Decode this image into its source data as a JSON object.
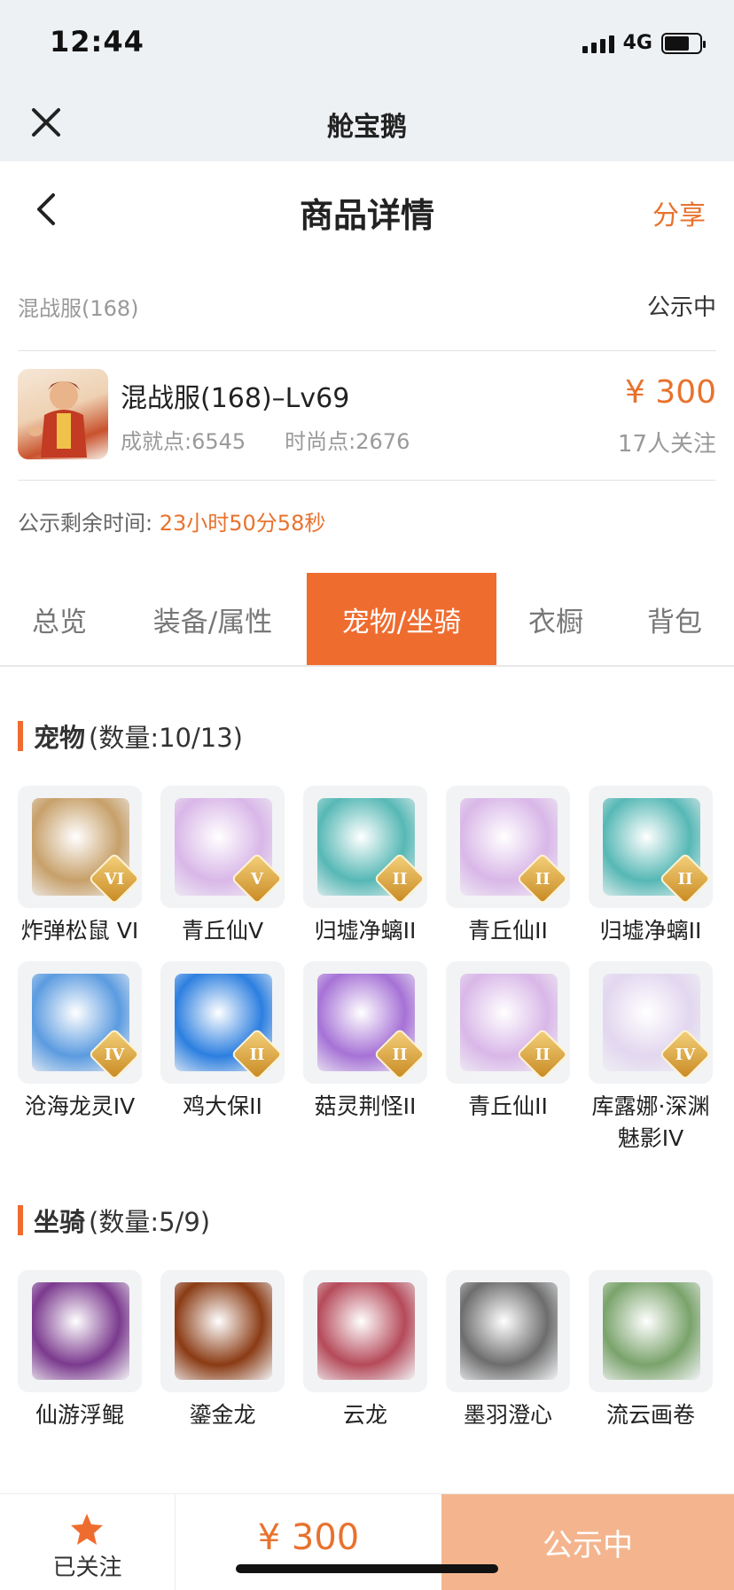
{
  "status": {
    "time": "12:44",
    "network": "4G"
  },
  "app": {
    "title": "舱宝鹅"
  },
  "page": {
    "title": "商品详情",
    "share": "分享"
  },
  "server": {
    "name": "混战服(168)",
    "status": "公示中"
  },
  "product": {
    "name": "混战服(168)–Lv69",
    "achievement": "成就点:6545",
    "fashion": "时尚点:2676",
    "price": "¥ 300",
    "followers": "17人关注"
  },
  "countdown": {
    "label": "公示剩余时间:",
    "value": "23小时50分58秒"
  },
  "tabs": [
    {
      "label": "总览"
    },
    {
      "label": "装备/属性"
    },
    {
      "label": "宠物/坐骑"
    },
    {
      "label": "衣橱"
    },
    {
      "label": "背包"
    }
  ],
  "pets": {
    "title": "宠物",
    "count": "(数量:10/13)",
    "items": [
      {
        "name": "炸弹松鼠 VI",
        "badge": "VI",
        "icon": "squirrel-pet-icon",
        "color": "#c7a06a"
      },
      {
        "name": "青丘仙V",
        "badge": "V",
        "icon": "fox-fairy-pet-icon",
        "color": "#d9b7e8"
      },
      {
        "name": "归墟净螭II",
        "badge": "II",
        "icon": "dragon-pet-icon",
        "color": "#56b8b5"
      },
      {
        "name": "青丘仙II",
        "badge": "II",
        "icon": "fox-fairy-pet-icon",
        "color": "#d9b7e8"
      },
      {
        "name": "归墟净螭II",
        "badge": "II",
        "icon": "dragon-pet-icon",
        "color": "#56b8b5"
      },
      {
        "name": "沧海龙灵IV",
        "badge": "IV",
        "icon": "sea-dragon-spirit-icon",
        "color": "#5b9be0"
      },
      {
        "name": "鸡大保II",
        "badge": "II",
        "icon": "blue-bird-pet-icon",
        "color": "#2c7fe0"
      },
      {
        "name": "菇灵荆怪II",
        "badge": "II",
        "icon": "mushroom-spirit-pet-icon",
        "color": "#a672d6"
      },
      {
        "name": "青丘仙II",
        "badge": "II",
        "icon": "fox-fairy-pet-icon",
        "color": "#d9b7e8"
      },
      {
        "name": "库露娜·深渊魅影IV",
        "badge": "IV",
        "icon": "abyss-phantom-pet-icon",
        "color": "#e2d7ef"
      }
    ]
  },
  "mounts": {
    "title": "坐骑",
    "count": "(数量:5/9)",
    "items": [
      {
        "name": "仙游浮鲲",
        "icon": "floating-whale-mount-icon",
        "color": "#7b3a8e"
      },
      {
        "name": "鎏金龙",
        "icon": "golden-dragon-mount-icon",
        "color": "#8a3b14"
      },
      {
        "name": "云龙",
        "icon": "cloud-dragon-mount-icon",
        "color": "#b54a5a"
      },
      {
        "name": "墨羽澄心",
        "icon": "ink-feather-mount-icon",
        "color": "#6d6d6d"
      },
      {
        "name": "流云画卷",
        "icon": "scroll-painting-mount-icon",
        "color": "#7aa36b"
      }
    ]
  },
  "bottom": {
    "follow_label": "已关注",
    "price": "¥ 300",
    "cta": "公示中"
  },
  "colors": {
    "accent": "#ef6c2f",
    "cta": "#f4b58e",
    "price": "#e8722e"
  }
}
